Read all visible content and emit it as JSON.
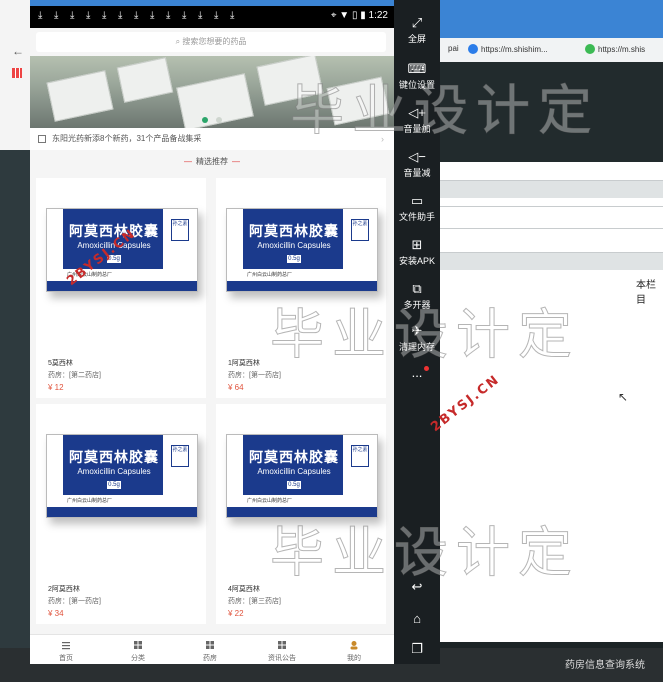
{
  "desktop": {
    "tabs": [
      {
        "label": "pai",
        "color": "#888888"
      },
      {
        "label": "https://m.shishim...",
        "color": "#2b7de9"
      },
      {
        "label": "https://m.shis",
        "color": "#3cba54"
      }
    ],
    "right_text": "本栏目",
    "taskbar_label": "药房信息查询系统"
  },
  "emulator_sidebar": [
    {
      "icon": "fullscreen-icon",
      "label": "全屏"
    },
    {
      "icon": "keyboard-icon",
      "label": "键位设置"
    },
    {
      "icon": "volume-up-icon",
      "label": "音量加"
    },
    {
      "icon": "volume-down-icon",
      "label": "音量减"
    },
    {
      "icon": "file-helper-icon",
      "label": "文件助手"
    },
    {
      "icon": "apk-install-icon",
      "label": "安装APK"
    },
    {
      "icon": "multi-instance-icon",
      "label": "多开器"
    },
    {
      "icon": "clean-memory-icon",
      "label": "清理内存"
    },
    {
      "icon": "more-icon",
      "label": "..."
    }
  ],
  "emulator_nav": [
    {
      "icon": "back-icon"
    },
    {
      "icon": "home-icon"
    },
    {
      "icon": "recent-apps-icon"
    }
  ],
  "phone": {
    "status_bar": {
      "time": "1:22"
    },
    "search": {
      "placeholder": "搜索您想要的药品"
    },
    "banner": {
      "dots": 2,
      "active_dot": 0
    },
    "notice": "东阳光药新添8个新药，31个产品备战集采",
    "section_title": "精选推荐",
    "products": [
      {
        "name": "5莫西林",
        "store": "药房：[第二药店]",
        "price": "¥ 12"
      },
      {
        "name": "1阿莫西林",
        "store": "药房：[第一药店]",
        "price": "¥ 64"
      },
      {
        "name": "2阿莫西林",
        "store": "药房：[第一药店]",
        "price": "¥ 34"
      },
      {
        "name": "4阿莫西林",
        "store": "药房：[第三药店]",
        "price": "¥ 22"
      }
    ],
    "product_box": {
      "cn_name": "阿莫西林胶囊",
      "en_name": "Amoxicillin Capsules",
      "dose": "0.5g",
      "brand": "孙之素",
      "maker": "广州白云山制药总厂"
    },
    "tabbar": [
      {
        "label": "首页",
        "icon": "home-tab-icon"
      },
      {
        "label": "分类",
        "icon": "category-tab-icon"
      },
      {
        "label": "药房",
        "icon": "pharmacy-tab-icon"
      },
      {
        "label": "资讯公告",
        "icon": "news-tab-icon"
      },
      {
        "label": "我的",
        "icon": "profile-tab-icon"
      }
    ]
  },
  "watermarks": {
    "cn": "毕业设计定",
    "en": "2BYSJ.CN"
  },
  "colors": {
    "price": "#e0533c",
    "accent_red": "#d33333",
    "box_blue": "#1b3a8c",
    "status_bar": "#000000",
    "emulator_sidebar": "#1a1f22"
  }
}
